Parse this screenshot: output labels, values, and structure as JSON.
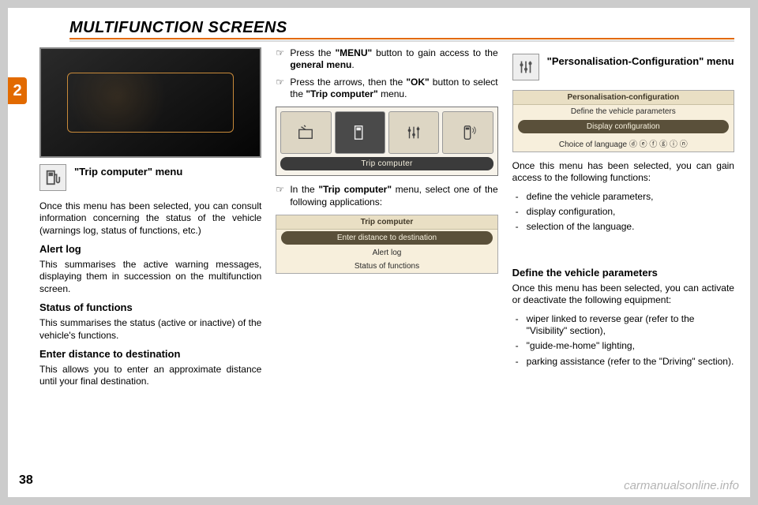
{
  "header": {
    "title": "MULTIFUNCTION SCREENS"
  },
  "tab": "2",
  "page_number": "38",
  "watermark": "carmanualsonline.info",
  "col1": {
    "section_title": "\"Trip computer\" menu",
    "intro": "Once this menu has been selected, you can consult information concerning the status of the vehicle (warnings log, status of functions, etc.)",
    "alert": {
      "heading": "Alert log",
      "text": "This summarises the active warning messages, displaying them in succession on the multifunction screen."
    },
    "status": {
      "heading": "Status of functions",
      "text": "This summarises the status (active or inactive) of the vehicle's functions."
    },
    "dist": {
      "heading": "Enter distance to destination",
      "text": "This allows you to enter an approximate distance until your final destination."
    }
  },
  "col2": {
    "step1_a": "Press the ",
    "step1_b": "\"MENU\"",
    "step1_c": " button to gain access to the ",
    "step1_d": "general menu",
    "step1_e": ".",
    "step2_a": "Press the arrows, then the ",
    "step2_b": "\"OK\"",
    "step2_c": " button to select the ",
    "step2_d": "\"Trip computer\"",
    "step2_e": " menu.",
    "menuA_label": "Trip computer",
    "step3_a": "In the ",
    "step3_b": "\"Trip computer\"",
    "step3_c": " menu, select one of the following applications:",
    "menuB": {
      "title": "Trip computer",
      "items": [
        "Enter distance to destination",
        "Alert log",
        "Status of functions"
      ],
      "selected_index": 0
    }
  },
  "col3": {
    "section_title": "\"Personalisation-Configuration\" menu",
    "menuB": {
      "title": "Personalisation-configuration",
      "items": [
        "Define the vehicle parameters",
        "Display configuration",
        "Choice of language ⓓ ⓔ ⓕ ⓖ ⓘ ⓝ"
      ],
      "selected_index": 1
    },
    "intro": "Once this menu has been selected, you can gain access to the following functions:",
    "funcs": [
      "define the vehicle parameters,",
      "display configuration,",
      "selection of the language."
    ],
    "define": {
      "heading": "Define the vehicle parameters",
      "text": "Once this menu has been selected, you can activate or deactivate the following equipment:",
      "items": [
        "wiper linked to reverse gear (refer to the \"Visibility\" section),",
        "\"guide-me-home\" lighting,",
        "parking assistance (refer to the \"Driving\" section)."
      ]
    }
  }
}
